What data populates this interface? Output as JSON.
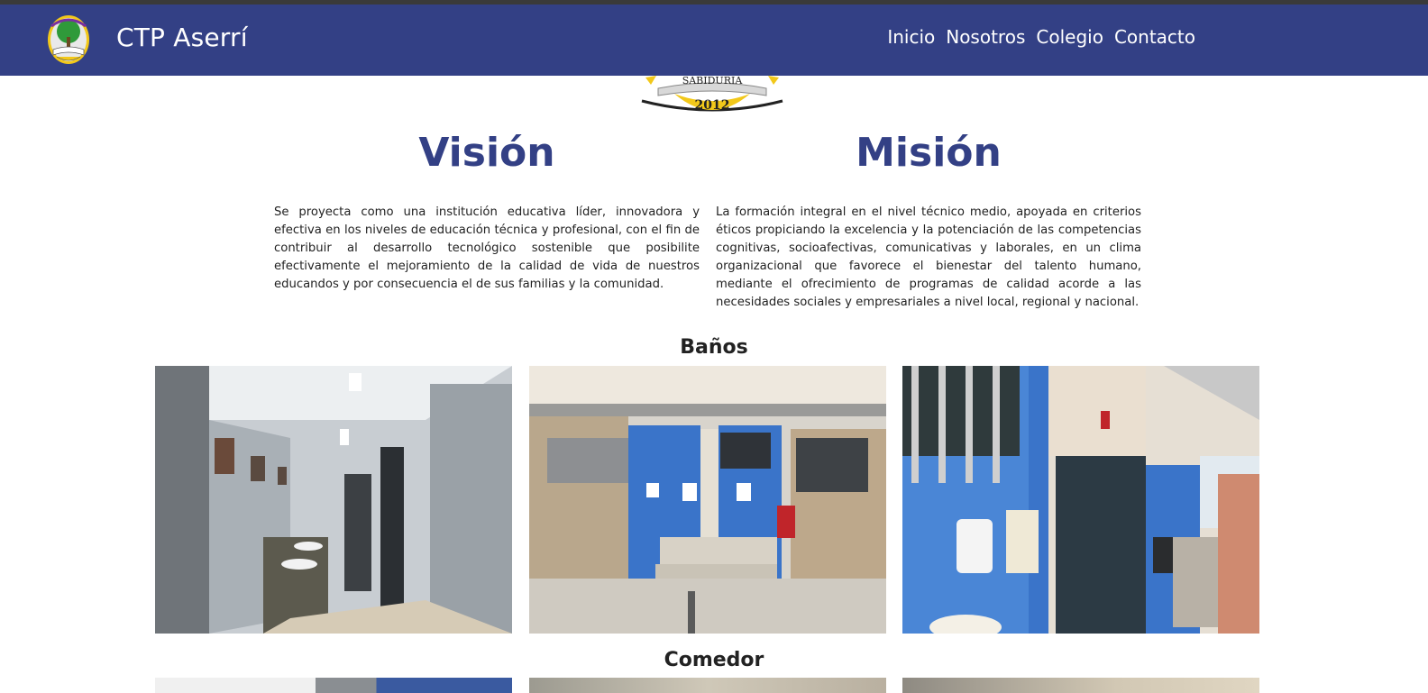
{
  "header": {
    "brand": "CTP Aserrí",
    "nav": [
      "Inicio",
      "Nosotros",
      "Colegio",
      "Contacto"
    ]
  },
  "crest": {
    "banner_text": "SABIDURIA",
    "year": "2012"
  },
  "vision": {
    "title": "Visión",
    "text": "Se proyecta como una institución educativa líder, innovadora y efectiva en los niveles de educación técnica y profesional, con el fin de contribuir al desarrollo tecnológico sostenible que posibilite efectivamente el mejoramiento de la calidad de vida de nuestros educandos y por consecuencia el de sus familias y la comunidad."
  },
  "mision": {
    "title": "Misión",
    "text": "La formación integral en el nivel técnico medio, apoyada en criterios éticos propiciando la excelencia y la potenciación de las competencias cognitivas, socioafectivas, comunicativas y laborales, en un clima organizacional que favorece el bienestar del talento humano, mediante el ofrecimiento de programas de calidad acorde a las necesidades sociales y empresariales a nivel local, regional y nacional."
  },
  "sections": [
    {
      "title": "Baños",
      "photos": [
        "bathroom-sinks-photo",
        "bathroom-entrance-photo",
        "bathroom-exterior-photo"
      ]
    },
    {
      "title": "Comedor",
      "photos": [
        "dining-photo-1",
        "dining-photo-2",
        "dining-photo-3"
      ]
    }
  ],
  "colors": {
    "primary": "#334085",
    "crest_yellow": "#f2c81a",
    "wall_blue": "#3f7fd0"
  }
}
